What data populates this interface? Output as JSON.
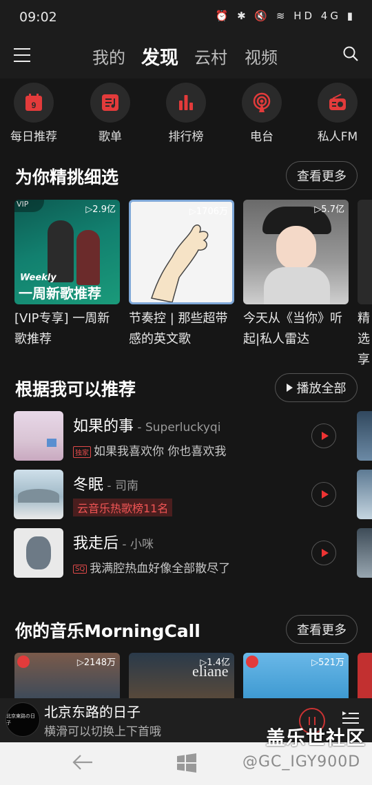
{
  "status": {
    "time": "09:02",
    "icons": "⏰ ✱ 🔇 ≋ HD 4G ▮"
  },
  "header": {
    "tabs": [
      "我的",
      "发现",
      "云村",
      "视频"
    ],
    "active_tab": "发现"
  },
  "quick": [
    {
      "label": "每日推荐",
      "icon": "calendar-icon",
      "day": "9"
    },
    {
      "label": "歌单",
      "icon": "playlist-icon"
    },
    {
      "label": "排行榜",
      "icon": "chart-bars-icon"
    },
    {
      "label": "电台",
      "icon": "radio-tower-icon"
    },
    {
      "label": "私人FM",
      "icon": "fm-radio-icon"
    }
  ],
  "picks": {
    "title": "为你精挑细选",
    "more": "查看更多",
    "cards": [
      {
        "plays": "▷2.9亿",
        "title": "[VIP专享] 一周新歌推荐",
        "badge": "VIP",
        "overlay_top": "Weekly",
        "overlay": "一周新歌推荐"
      },
      {
        "plays": "▷1706万",
        "title": "节奏控 | 那些超带感的英文歌"
      },
      {
        "plays": "▷5.7亿",
        "title": "今天从《当你》听起|私人雷达"
      },
      {
        "plays": "",
        "title": "精选享"
      }
    ]
  },
  "recommend": {
    "title": "根据我可以推荐",
    "play_all": "播放全部",
    "songs": [
      {
        "name": "如果的事",
        "artist": " - Superluckyqi",
        "tag": "独家",
        "sub": "如果我喜欢你 你也喜欢我"
      },
      {
        "name": "冬眠",
        "artist": " - 司南",
        "tag": "",
        "sub": "云音乐热歌榜11名"
      },
      {
        "name": "我走后",
        "artist": " - 小咪",
        "tag": "SQ",
        "sub": "我满腔热血好像全部散尽了"
      }
    ]
  },
  "morning": {
    "title": "你的音乐MorningCall",
    "more": "查看更多",
    "cards": [
      {
        "plays": "▷2148万"
      },
      {
        "plays": "▷1.4亿",
        "overlay": "eliane"
      },
      {
        "plays": "▷521万"
      }
    ]
  },
  "player": {
    "title": "北京东路的日子",
    "sub": "横滑可以切换上下首哦",
    "disc_text": "北京東路の日子"
  },
  "watermark": {
    "line1": "盖乐世社区",
    "line2": "@GC_IGY900D"
  },
  "colors": {
    "accent": "#e33b3b",
    "background": "#161616"
  }
}
